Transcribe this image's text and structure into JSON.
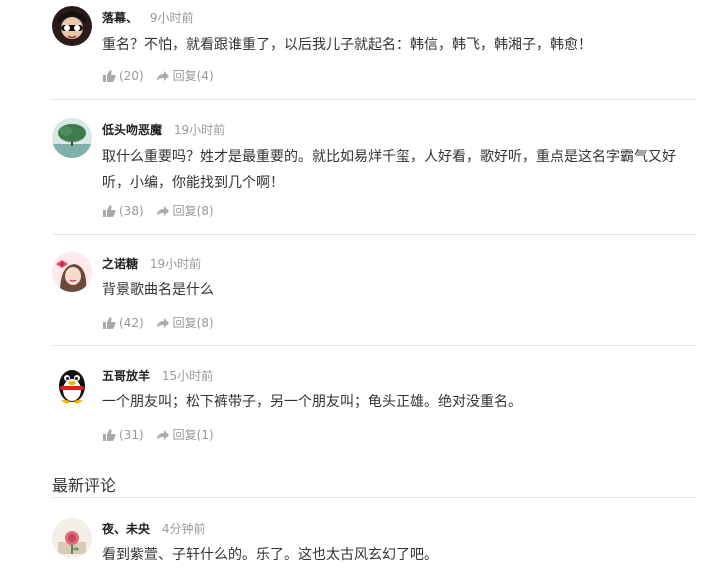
{
  "comments": [
    {
      "user": "落幕、",
      "time": "9小时前",
      "text": "重名？不怕，就看跟谁重了，以后我儿子就起名：韩信，韩飞，韩湘子，韩愈！",
      "likes": "(20)",
      "reply": "回复(4)",
      "avatar_icon": "dark-cartoon-avatar"
    },
    {
      "user": "低头吻恶魔",
      "time": "19小时前",
      "text": "取什么重要吗？姓才是最重要的。就比如易烊千玺，人好看，歌好听，重点是这名字霸气又好听，小编，你能找到几个啊！",
      "likes": "(38)",
      "reply": "回复(8)",
      "avatar_icon": "tree-landscape-avatar"
    },
    {
      "user": "之诺糖",
      "time": "19小时前",
      "text": "背景歌曲名是什么",
      "likes": "(42)",
      "reply": "回复(8)",
      "avatar_icon": "girl-with-bow-avatar"
    },
    {
      "user": "五哥放羊",
      "time": "15小时前",
      "text": "一个朋友叫；松下裤带子，另一个朋友叫；龟头正雄。绝对没重名。",
      "likes": "(31)",
      "reply": "回复(1)",
      "avatar_icon": "qq-penguin-avatar"
    }
  ],
  "latest_section": {
    "title": "最新评论",
    "comment": {
      "user": "夜、未央",
      "time": "4分钟前",
      "text": "看到紫萱、子轩什么的。乐了。这也太古风玄幻了吧。",
      "avatar_icon": "rose-avatar"
    }
  },
  "colors": {
    "text": "#333333",
    "muted": "#999999",
    "divider": "#e6e6e6"
  }
}
